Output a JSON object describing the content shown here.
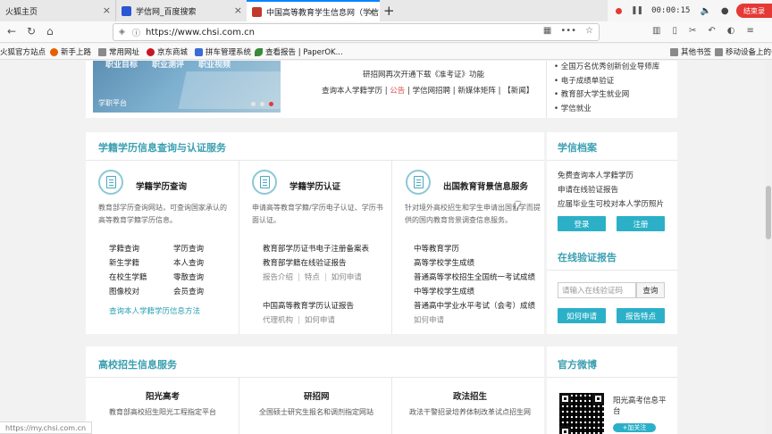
{
  "browser": {
    "tabs": [
      {
        "label": "火狐主页",
        "active": false
      },
      {
        "label": "学信网_百度搜索",
        "active": false
      },
      {
        "label": "中国高等教育学生信息网（学信",
        "active": true
      }
    ],
    "new_tab": "+",
    "url": "https://www.chsi.com.cn",
    "nav": {
      "back": "←",
      "forward": "→",
      "reload": "↻",
      "home": "⌂"
    },
    "url_icons": {
      "qr": "▦",
      "more": "•••",
      "star": "☆"
    },
    "bookmarks": [
      {
        "label": "火狐官方站点",
        "icon": "fire-icon"
      },
      {
        "label": "新手上路",
        "icon": "fire-icon"
      },
      {
        "label": "常用网址",
        "icon": "folder-icon"
      },
      {
        "label": "京东商城",
        "icon": "globe-icon"
      },
      {
        "label": "拼车管理系统",
        "icon": "car-icon"
      },
      {
        "label": "查看报告 | PaperOK...",
        "icon": "leaf-icon"
      },
      {
        "label": "其他书签",
        "icon": "folder-icon"
      },
      {
        "label": "移动设备上的书",
        "icon": "folder-icon"
      }
    ]
  },
  "recorder": {
    "time": "00:00:15",
    "end_label": "结束录"
  },
  "top": {
    "banner_tabs": [
      "职业目标",
      "职业测评",
      "职业视频"
    ],
    "banner_label": "学职平台",
    "line1": "研招网再次开通下载《准考证》功能",
    "links": {
      "a": "查询本人学籍学历",
      "sep1": " | ",
      "b": "公告",
      "sep2": " | ",
      "c": "学信网招聘",
      "sep3": " | ",
      "d": "新媒体矩阵",
      "sep4": " | ",
      "e": "【新闻】"
    },
    "right_list": [
      "• 全国万名优秀创新创业导师库",
      "• 电子成绩单验证",
      "• 教育部大学生就业网",
      "• 学信就业"
    ]
  },
  "academic": {
    "title": "学籍学历信息查询与认证服务",
    "col1": {
      "title": "学籍学历查询",
      "desc": "教育部学历查询网站，可查询国家承认的高等教育学籍学历信息。",
      "links": [
        "学籍查询",
        "学历查询",
        "新生学籍",
        "本人查询",
        "在校生学籍",
        "零散查询",
        "图像校对",
        "会员查询"
      ],
      "method": "查询本人学籍学历信息方法"
    },
    "col2": {
      "title": "学籍学历认证",
      "desc": "申请高等教育学籍/学历电子认证、学历书面认证。",
      "item1": "教育部学历证书电子注册备案表",
      "item2": "教育部学籍在线验证报告",
      "sub1": [
        "报告介绍",
        "特点",
        "如何申请"
      ],
      "item3": "中国高等教育学历认证报告",
      "sub2": [
        "代理机构",
        "如何申请"
      ]
    },
    "col3": {
      "title": "出国教育背景信息服务",
      "desc": "针对境外高校招生和学生申请出国留学而提供的国内教育背景调查信息服务。",
      "items": [
        "中等教育学历",
        "高等学校学生成绩",
        "普通高等学校招生全国统一考试成绩",
        "中等学校学生成绩",
        "普通高中学业水平考试（会考）成绩"
      ],
      "sub": "如何申请"
    }
  },
  "archive": {
    "title": "学信档案",
    "lines": [
      "免费查询本人学籍学历",
      "申请在线验证报告",
      "应届毕业生可校对本人学历照片"
    ],
    "login": "登录",
    "register": "注册"
  },
  "verify": {
    "title": "在线验证报告",
    "placeholder": "请输入在线验证码",
    "query": "查询",
    "apply": "如何申请",
    "features": "报告特点"
  },
  "enroll": {
    "title": "高校招生信息服务",
    "cols": [
      {
        "title": "阳光高考",
        "desc": "教育部高校招生阳光工程指定平台"
      },
      {
        "title": "研招网",
        "desc": "全国硕士研究生报名和调剂指定网站"
      },
      {
        "title": "政法招生",
        "desc": "政法干警招录培养体制改革试点招生网"
      }
    ]
  },
  "weibo": {
    "title": "官方微博",
    "account": "阳光高考信息平台",
    "follow": "+加关注"
  },
  "status": {
    "text": "https://my.chsi.com.cn"
  }
}
